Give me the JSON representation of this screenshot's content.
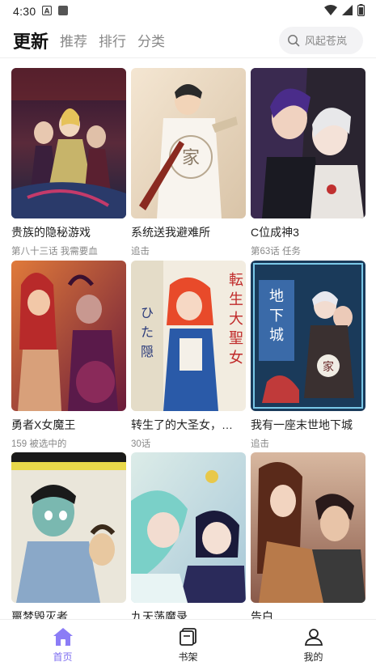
{
  "status_bar": {
    "time": "4:30"
  },
  "header": {
    "tabs": [
      {
        "label": "更新",
        "active": true
      },
      {
        "label": "推荐",
        "active": false
      },
      {
        "label": "排行",
        "active": false
      },
      {
        "label": "分类",
        "active": false
      }
    ],
    "search_placeholder": "风起苍岚"
  },
  "comics": [
    {
      "title": "贵族的隐秘游戏",
      "subtitle": "第八十三话 我需要血"
    },
    {
      "title": "系统送我避难所",
      "subtitle": "追击"
    },
    {
      "title": "C位成神3",
      "subtitle": "第63话 任务"
    },
    {
      "title": "勇者X女魔王",
      "subtitle": "159 被选中的"
    },
    {
      "title": "转生了的大圣女，…",
      "subtitle": "30话"
    },
    {
      "title": "我有一座末世地下城",
      "subtitle": "追击"
    },
    {
      "title": "噩梦毁灭者",
      "subtitle": ""
    },
    {
      "title": "九天荡魔录",
      "subtitle": ""
    },
    {
      "title": "告白",
      "subtitle": ""
    }
  ],
  "bottom_nav": [
    {
      "label": "首页",
      "icon": "home-icon",
      "active": true
    },
    {
      "label": "书架",
      "icon": "bookshelf-icon",
      "active": false
    },
    {
      "label": "我的",
      "icon": "profile-icon",
      "active": false
    }
  ],
  "colors": {
    "accent": "#7c6cf0",
    "text": "#222222",
    "muted": "#888888"
  }
}
